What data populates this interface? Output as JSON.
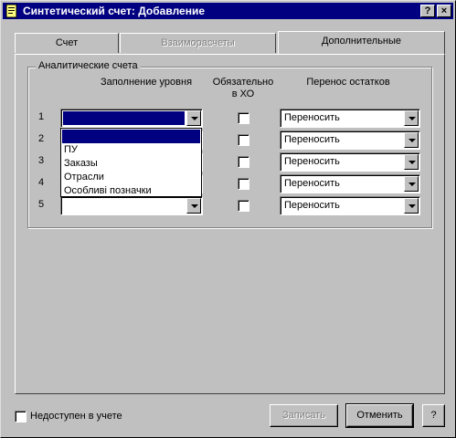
{
  "window": {
    "title": "Синтетический счет: Добавление",
    "help_glyph": "?",
    "close_glyph": "×"
  },
  "tabs": [
    {
      "label": "Счет",
      "state": "normal"
    },
    {
      "label": "Взаиморасчеты",
      "state": "disabled"
    },
    {
      "label": "Дополнительные",
      "state": "active"
    }
  ],
  "group": {
    "label": "Аналитические счета",
    "headers": {
      "fill_level": "Заполнение уровня",
      "mandatory": "Обязательно в ХО",
      "carry_over": "Перенос остатков"
    },
    "rows": [
      {
        "num": "1",
        "level_value": "",
        "mandatory": false,
        "carry": "Переносить"
      },
      {
        "num": "2",
        "level_value": "",
        "mandatory": false,
        "carry": "Переносить"
      },
      {
        "num": "3",
        "level_value": "",
        "mandatory": false,
        "carry": "Переносить"
      },
      {
        "num": "4",
        "level_value": "",
        "mandatory": false,
        "carry": "Переносить"
      },
      {
        "num": "5",
        "level_value": "",
        "mandatory": false,
        "carry": "Переносить"
      }
    ]
  },
  "dropdown": {
    "options": [
      "",
      "ПУ",
      "Заказы",
      "Отрасли",
      "Особливі позначки"
    ],
    "selected_index": 0
  },
  "footer": {
    "unavailable_label": "Недоступен в учете",
    "unavailable_checked": false,
    "save_label": "Записать",
    "cancel_label": "Отменить",
    "help_label": "?"
  },
  "colors": {
    "title_bar": "#000080",
    "face": "#c0c0c0",
    "selection": "#000080"
  }
}
